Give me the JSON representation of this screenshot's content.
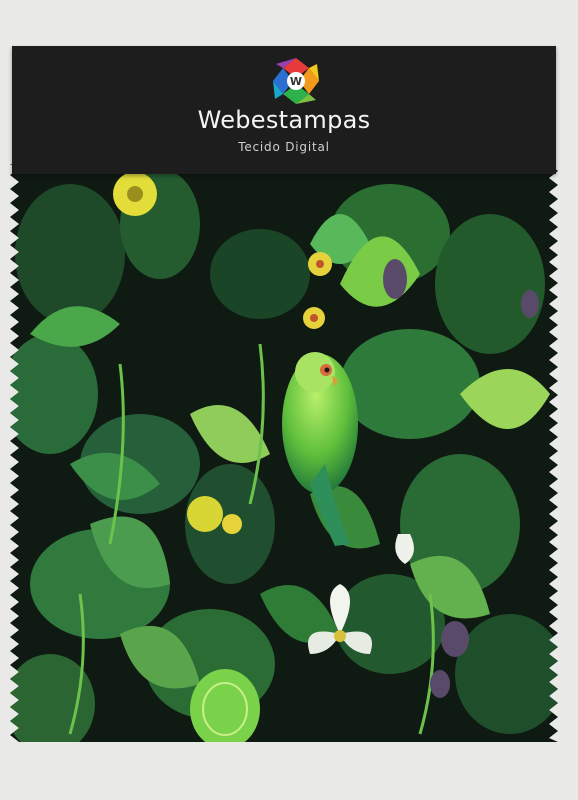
{
  "brand": {
    "name": "Webestampas",
    "tagline": "Tecido Digital"
  },
  "colors": {
    "background": "#e9e9e7",
    "header": "#1d1d1d",
    "brand_text": "#f4f4f4",
    "fabric_base": "#0f1a12"
  },
  "swatch": {
    "pattern": "tropical jungle foliage with green parrot and flowers"
  }
}
